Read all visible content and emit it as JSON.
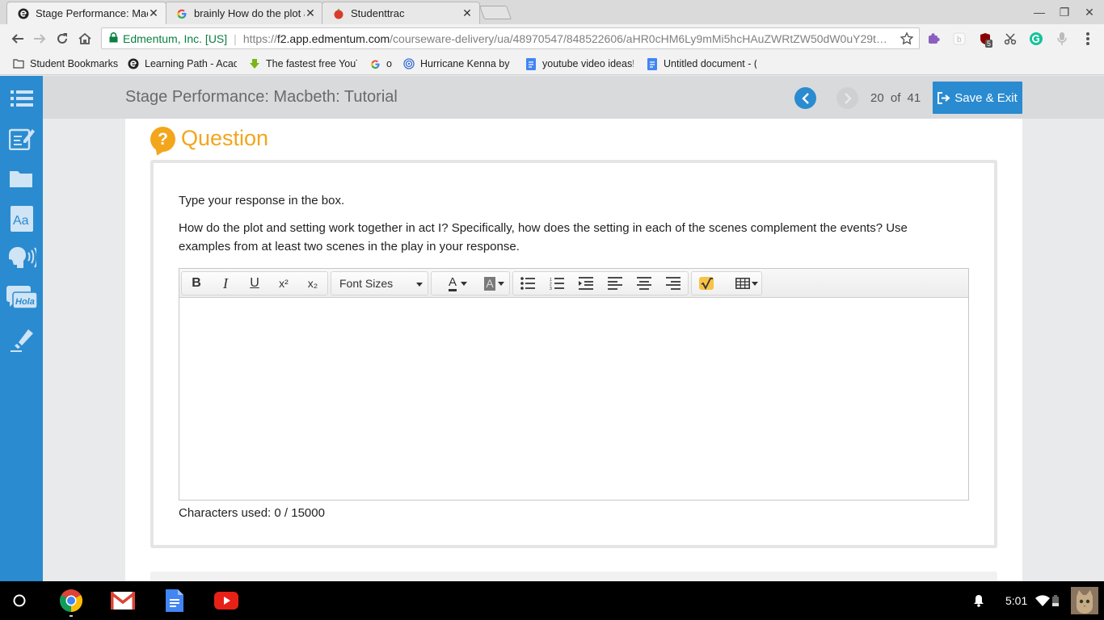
{
  "browser": {
    "tabs": [
      {
        "title": "Stage Performance: Mac",
        "active": true,
        "favicon": "edmentum-icon"
      },
      {
        "title": "brainly How do the plot a",
        "active": false,
        "favicon": "google-icon"
      },
      {
        "title": "Studenttrac",
        "active": false,
        "favicon": "apple-icon"
      }
    ],
    "tab_close_glyph": "✕",
    "window": {
      "minimize": "—",
      "restore": "❐",
      "close": "✕"
    },
    "address": {
      "org": "Edmentum, Inc. [US]",
      "scheme": "https://",
      "host": "f2.app.edmentum.com",
      "path": "/courseware-delivery/ua/48970547/848522606/aHR0cHM6Ly9mMi5hcHAuZWRtZW50dW0uY29t…"
    },
    "extension_badge": "5",
    "bookmarks": [
      {
        "label": "Student Bookmarks",
        "icon": "folder-icon"
      },
      {
        "label": "Learning Path - Acad",
        "icon": "edmentum-icon"
      },
      {
        "label": "The fastest free YouT",
        "icon": "download-arrow-icon"
      },
      {
        "label": "o",
        "icon": "google-icon"
      },
      {
        "label": "Hurricane Kenna by",
        "icon": "target-icon"
      },
      {
        "label": "youtube video ideas!",
        "icon": "docs-icon"
      },
      {
        "label": "Untitled document - (",
        "icon": "docs-icon"
      }
    ]
  },
  "lesson": {
    "title": "Stage Performance: Macbeth: Tutorial",
    "page_current": "20",
    "page_of": "of",
    "page_total": "41",
    "save_exit_label": "Save & Exit"
  },
  "question": {
    "icon_glyph": "?",
    "heading": "Question",
    "instruction": "Type your response in the box.",
    "prompt": "How do the plot and setting work together in act I? Specifically, how does the setting in each of the scenes complement the events? Use examples from at least two scenes in the play in your response."
  },
  "editor": {
    "buttons": {
      "bold": "B",
      "italic": "I",
      "underline": "U",
      "superscript": "x²",
      "subscript": "x₂"
    },
    "font_sizes_label": "Font Sizes",
    "text_color_glyph": "A",
    "bg_color_glyph": "A",
    "value": "",
    "characters_used_label": "Characters used: 0 / 15000"
  },
  "shelf": {
    "time": "5:01",
    "apps": [
      "chrome-icon",
      "gmail-icon",
      "docs-icon",
      "youtube-icon"
    ]
  },
  "colors": {
    "accent_blue": "#2a8bd0",
    "question_orange": "#f3a51b",
    "org_green": "#0b8043"
  }
}
